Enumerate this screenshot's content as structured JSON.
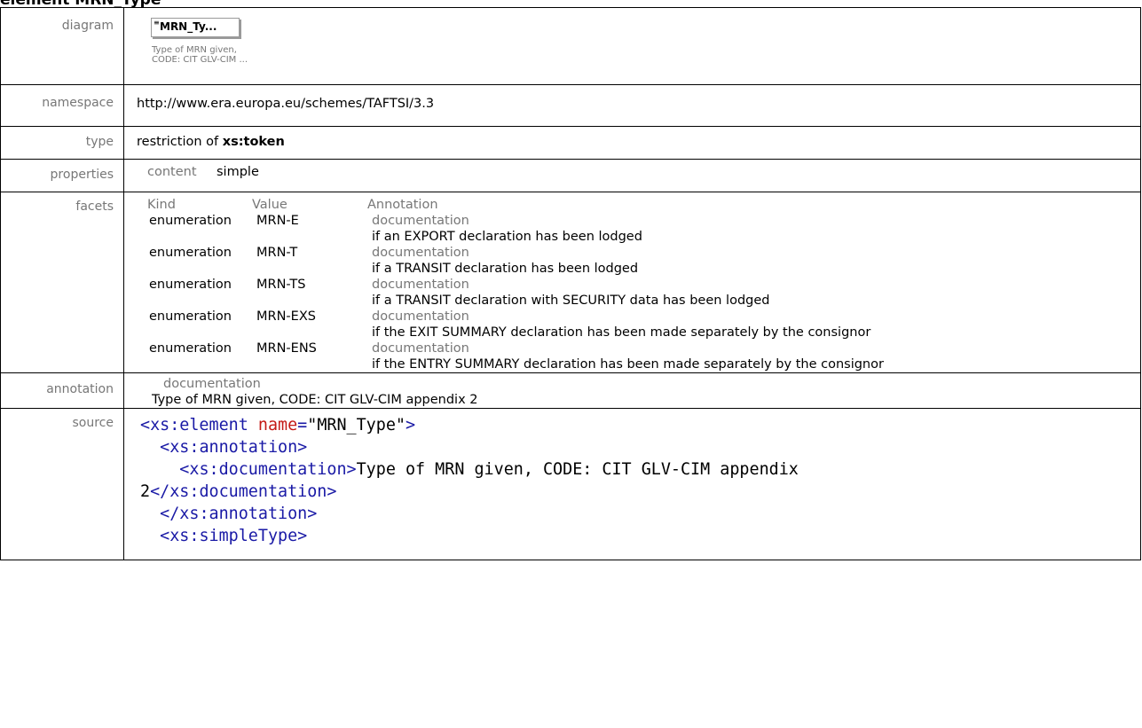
{
  "page_heading": "element MRN_Type",
  "rows": {
    "diagram": {
      "label": "diagram",
      "box_glyph": "≡",
      "box_name": "MRN_Ty...",
      "note_line1": "Type of MRN given,",
      "note_line2": "CODE: CIT GLV-CIM ..."
    },
    "namespace": {
      "label": "namespace",
      "value": "http://www.era.europa.eu/schemes/TAFTSI/3.3"
    },
    "type": {
      "label": "type",
      "prefix": "restriction of ",
      "base": "xs:token"
    },
    "properties": {
      "label": "properties",
      "key": "content",
      "value": "simple"
    },
    "facets": {
      "label": "facets",
      "headers": {
        "kind": "Kind",
        "value": "Value",
        "annotation": "Annotation"
      },
      "items": [
        {
          "kind": "enumeration",
          "value": "MRN-E",
          "doc_label": "documentation",
          "doc": "if an EXPORT declaration has been lodged"
        },
        {
          "kind": "enumeration",
          "value": "MRN-T",
          "doc_label": "documentation",
          "doc": "if a TRANSIT declaration has been lodged"
        },
        {
          "kind": "enumeration",
          "value": "MRN-TS",
          "doc_label": "documentation",
          "doc": "if a TRANSIT declaration with SECURITY data has been lodged"
        },
        {
          "kind": "enumeration",
          "value": "MRN-EXS",
          "doc_label": "documentation",
          "doc": "if the EXIT SUMMARY declaration has been made separately by the consignor"
        },
        {
          "kind": "enumeration",
          "value": "MRN-ENS",
          "doc_label": "documentation",
          "doc": "if the ENTRY SUMMARY declaration has been made separately by the consignor"
        }
      ]
    },
    "annotation": {
      "label": "annotation",
      "doc_label": "documentation",
      "text": "Type of MRN given, CODE: CIT GLV-CIM appendix 2"
    },
    "source": {
      "label": "source",
      "code": {
        "l1_tag_open": "<xs:element",
        "l1_attr_name": "name",
        "l1_attr_val": "\"MRN_Type\"",
        "l1_close": ">",
        "l2": "<xs:annotation>",
        "l3_open": "<xs:documentation>",
        "l3_text": "Type of MRN given, CODE: CIT GLV-CIM appendix",
        "l4_text": "2",
        "l4_close": "</xs:documentation>",
        "l5": "</xs:annotation>",
        "l6": "<xs:simpleType>"
      }
    }
  },
  "colors": {
    "label_gray": "#777777",
    "border": "#000000",
    "xml_tag": "#1a1aa6",
    "xml_attr_name": "#c41a16"
  }
}
